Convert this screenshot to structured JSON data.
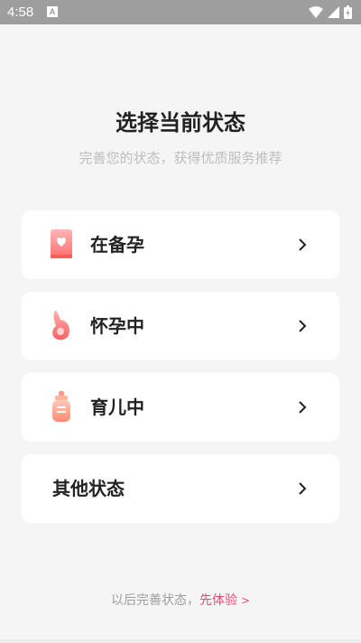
{
  "status_bar": {
    "time": "4:58",
    "notification_badge": "A",
    "icons": [
      "wifi-icon",
      "signal-icon",
      "battery-icon"
    ]
  },
  "header": {
    "title": "选择当前状态",
    "subtitle": "完善您的状态，获得优质服务推荐"
  },
  "options": [
    {
      "label": "在备孕",
      "icon": "pregnancy-prep-book-icon"
    },
    {
      "label": "怀孕中",
      "icon": "pregnant-belly-icon"
    },
    {
      "label": "育儿中",
      "icon": "baby-bottle-icon"
    },
    {
      "label": "其他状态",
      "icon": ""
    }
  ],
  "footer": {
    "text": "以后完善状态，",
    "link": "先体验",
    "arrow": ">"
  },
  "colors": {
    "accent": "#e84a78",
    "background": "#f5f5f5",
    "card": "#ffffff",
    "status_bar": "#9e9e9e"
  }
}
